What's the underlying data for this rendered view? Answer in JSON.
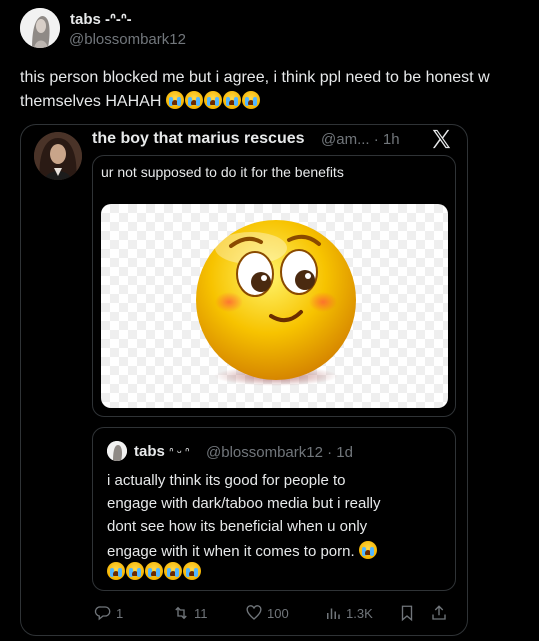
{
  "post": {
    "author_name": "tabs -ᐢ-ᐢ-",
    "author_handle": "@blossombark12",
    "text_line1": "this person blocked me but i agree, i think ppl need to be honest w",
    "text_line2": "themselves HAHAH"
  },
  "quote": {
    "author_name": "the boy that marius rescues",
    "author_handle": "@am... · 1h",
    "brand_icon": "x-logo-icon",
    "inner_text": "ur not supposed to do it for the benefits",
    "media_icon": "flushed-smiley-emoji-icon",
    "nested": {
      "author_name": "tabs",
      "author_decoration": "ᐢ ᵕ ᐢ",
      "author_handle": "@blossombark12 · 1d",
      "lines": [
        "i actually think its good for people to",
        "engage with dark/taboo media but i really",
        "dont see how its beneficial when u only",
        "engage with it when it comes to porn."
      ]
    },
    "actions": {
      "replies": "1",
      "reposts": "11",
      "likes": "100",
      "views": "1.3K"
    }
  },
  "colors": {
    "background": "#000000",
    "text": "#e7e9ea",
    "muted": "#71767b",
    "border": "#2f3336"
  }
}
